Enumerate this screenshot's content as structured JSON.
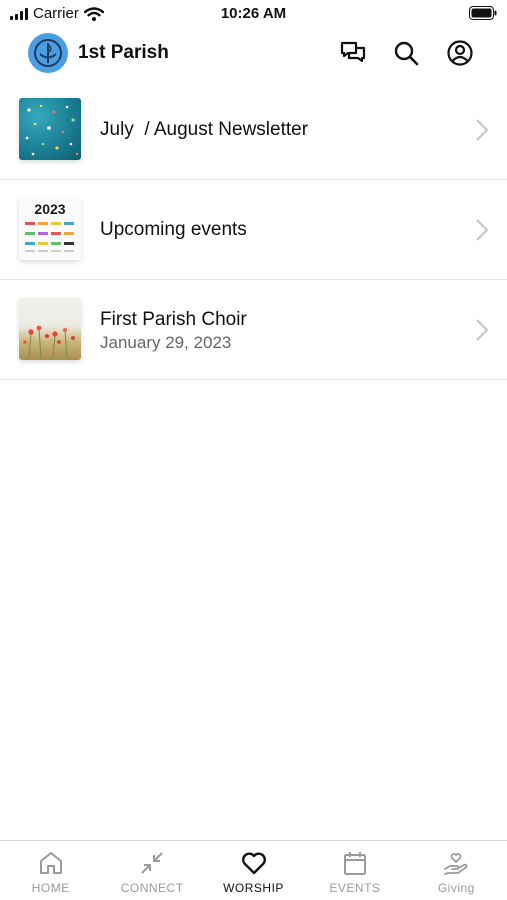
{
  "status_bar": {
    "carrier": "Carrier",
    "time": "10:26 AM"
  },
  "header": {
    "app_title": "1st Parish"
  },
  "list": {
    "items": [
      {
        "title": "July  / August Newsletter",
        "subtitle": ""
      },
      {
        "title": "Upcoming events",
        "subtitle": "",
        "thumb_text": "2023"
      },
      {
        "title": "First Parish Choir",
        "subtitle": "January 29, 2023"
      }
    ]
  },
  "tabbar": {
    "tabs": [
      {
        "label": "HOME",
        "icon": "home-icon"
      },
      {
        "label": "CONNECT",
        "icon": "connect-arrows-icon"
      },
      {
        "label": "WORSHIP",
        "icon": "heart-icon",
        "active": true
      },
      {
        "label": "EVENTS",
        "icon": "calendar-icon"
      },
      {
        "label": "Giving",
        "icon": "giving-hand-heart-icon"
      }
    ]
  },
  "colors": {
    "logo_blue": "#4a9fe3",
    "active_tab": "#111111",
    "inactive_tab": "#9a9a9a"
  }
}
